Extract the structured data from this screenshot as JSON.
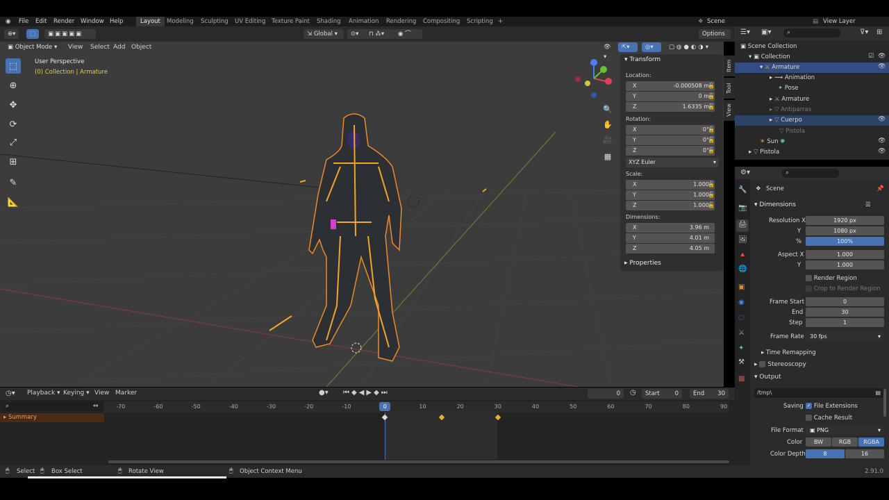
{
  "menu": {
    "file": "File",
    "edit": "Edit",
    "render": "Render",
    "window": "Window",
    "help": "Help"
  },
  "workspaces": [
    "Layout",
    "Modeling",
    "Sculpting",
    "UV Editing",
    "Texture Paint",
    "Shading",
    "Animation",
    "Rendering",
    "Compositing",
    "Scripting"
  ],
  "scene_label": "Scene",
  "view_layer_label": "View Layer",
  "toolbar": {
    "orientation": "Global",
    "options": "Options"
  },
  "viewport_header": {
    "mode": "Object Mode",
    "view": "View",
    "select": "Select",
    "add": "Add",
    "object": "Object"
  },
  "viewport_info": {
    "perspective": "User Perspective",
    "collection": "(0) Collection | Armature"
  },
  "npanel": {
    "transform_title": "Transform",
    "location_label": "Location:",
    "location": {
      "x": "-0.000508 m",
      "y": "0 m",
      "z": "1.6335 m"
    },
    "rotation_label": "Rotation:",
    "rotation": {
      "x": "0°",
      "y": "0°",
      "z": "0°"
    },
    "rotation_mode": "XYZ Euler",
    "scale_label": "Scale:",
    "scale": {
      "x": "1.000",
      "y": "1.000",
      "z": "1.000"
    },
    "dimensions_label": "Dimensions:",
    "dimensions": {
      "x": "3.96 m",
      "y": "4.01 m",
      "z": "4.05 m"
    },
    "properties_title": "Properties",
    "axis": {
      "x": "X",
      "y": "Y",
      "z": "Z"
    }
  },
  "side_tabs": [
    "Item",
    "Tool",
    "View"
  ],
  "outliner": {
    "scene_collection": "Scene Collection",
    "items": [
      {
        "label": "Collection"
      },
      {
        "label": "Armature"
      },
      {
        "label": "Animation"
      },
      {
        "label": "Pose"
      },
      {
        "label": "Armature"
      },
      {
        "label": "Antiparras"
      },
      {
        "label": "Cuerpo"
      },
      {
        "label": "Pistola"
      },
      {
        "label": "Sun"
      },
      {
        "label": "Pistola"
      }
    ]
  },
  "properties": {
    "scene": "Scene",
    "dimensions": "Dimensions",
    "resolution_x_label": "Resolution X",
    "resolution_x": "1920 px",
    "y_label": "Y",
    "resolution_y": "1080 px",
    "percent_label": "%",
    "percent": "100%",
    "aspect_x_label": "Aspect X",
    "aspect_x": "1.000",
    "aspect_y": "1.000",
    "render_region": "Render Region",
    "crop": "Crop to Render Region",
    "frame_start_label": "Frame Start",
    "frame_start": "0",
    "end_label": "End",
    "frame_end": "30",
    "step_label": "Step",
    "step": "1",
    "frame_rate_label": "Frame Rate",
    "frame_rate": "30 fps",
    "time_remapping": "Time Remapping",
    "stereoscopy": "Stereoscopy",
    "output": "Output",
    "output_path": "/tmp\\",
    "saving_label": "Saving",
    "file_extensions": "File Extensions",
    "cache_result": "Cache Result",
    "file_format_label": "File Format",
    "file_format": "PNG",
    "color_label": "Color",
    "color_bw": "BW",
    "color_rgb": "RGB",
    "color_rgba": "RGBA",
    "depth_label": "Color Depth",
    "depth_8": "8",
    "depth_16": "16"
  },
  "timeline": {
    "playback": "Playback",
    "keying": "Keying",
    "view": "View",
    "marker": "Marker",
    "current_frame": "0",
    "start_label": "Start",
    "start": "0",
    "end_label": "End",
    "end": "30",
    "summary": "Summary",
    "ruler": [
      "-70",
      "-60",
      "-50",
      "-40",
      "-30",
      "-20",
      "-10",
      "0",
      "10",
      "20",
      "30",
      "40",
      "50",
      "60",
      "70",
      "80",
      "90"
    ]
  },
  "statusbar": {
    "select": "Select",
    "box_select": "Box Select",
    "rotate": "Rotate View",
    "context": "Object Context Menu",
    "version": "2.91.0"
  },
  "colors": {
    "accent": "#4772b3",
    "selection": "#f5a623",
    "active_ws": "#393939",
    "panel": "#303030"
  }
}
